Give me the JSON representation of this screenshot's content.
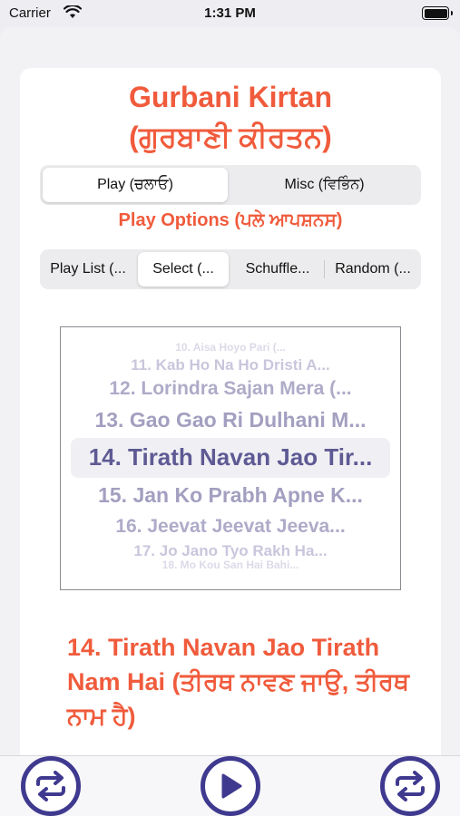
{
  "status": {
    "carrier": "Carrier",
    "time": "1:31 PM"
  },
  "header": {
    "title_line1": "Gurbani Kirtan",
    "title_line2": "(ਗੁਰਬਾਣੀ ਕੀਰਤਨ)"
  },
  "main_tabs": [
    {
      "label": "Play (ਚਲਾਓ)",
      "selected": true
    },
    {
      "label": "Misc (ਵਿਭਿੰਨ)",
      "selected": false
    }
  ],
  "section_label": "Play Options (ਪਲੇ ਆਪਸ਼ਨਸ)",
  "play_options": [
    {
      "label": "Play List (...",
      "selected": false
    },
    {
      "label": "Select (...",
      "selected": true
    },
    {
      "label": "Schuffle...",
      "selected": false
    },
    {
      "label": "Random (...",
      "selected": false
    }
  ],
  "picker": {
    "rows": [
      "10. Aisa Hoyo Pari (...",
      "11. Kab Ho Na Ho Dristi A...",
      "12. Lorindra Sajan Mera (...",
      "13. Gao Gao Ri Dulhani M...",
      "14. Tirath Navan Jao Tir...",
      "15. Jan Ko Prabh Apne K...",
      "16. Jeevat Jeevat Jeeva...",
      "17. Jo Jano Tyo Rakh Ha...",
      "18. Mo Kou San Hai Bahi..."
    ],
    "selected_index": 4
  },
  "current_track": "14. Tirath Navan Jao Tirath Nam Hai (ਤੀਰਥ ਨਾਵਣ ਜਾਉ, ਤੀਰਥ ਨਾਮ ਹੈ)",
  "colors": {
    "accent": "#f05b3c",
    "button_ring": "#3f3a8f",
    "picker_selected": "#5e5a94"
  },
  "toolbar": {
    "left_icon": "repeat-icon",
    "center_icon": "play-icon",
    "right_icon": "repeat-icon"
  }
}
